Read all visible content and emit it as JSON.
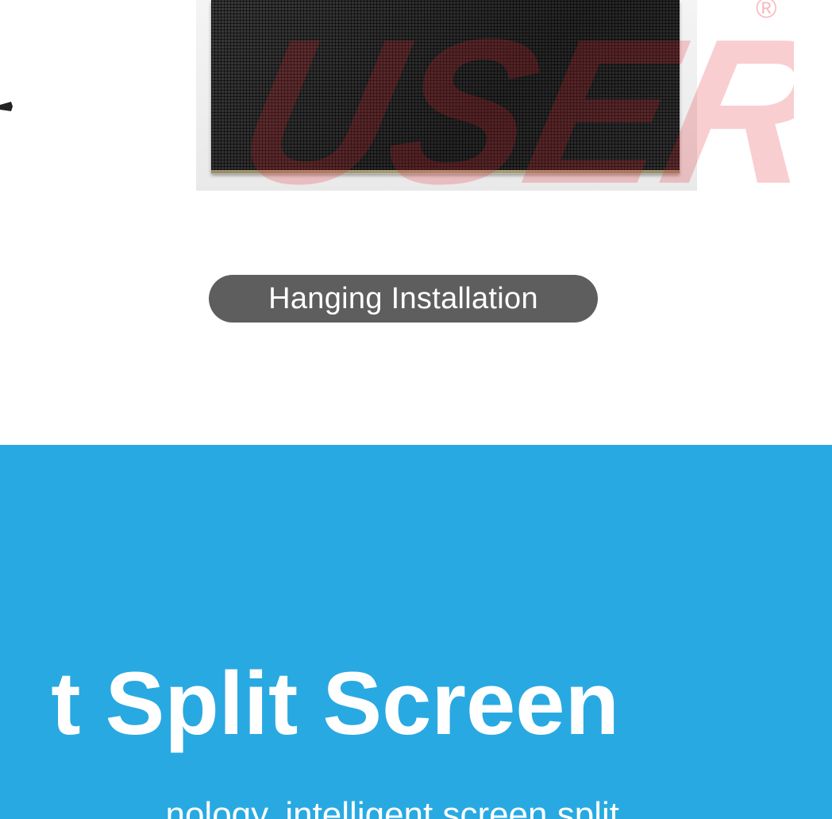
{
  "product_section": {
    "installation_label": "Hanging Installation",
    "watermark_text": "USER",
    "watermark_mark": "®",
    "watermark_color": "#e41e2a"
  },
  "feature_section": {
    "background_color": "#29a9e1",
    "headline": "t Split Screen",
    "subline": "nology, intelligent screen split"
  }
}
